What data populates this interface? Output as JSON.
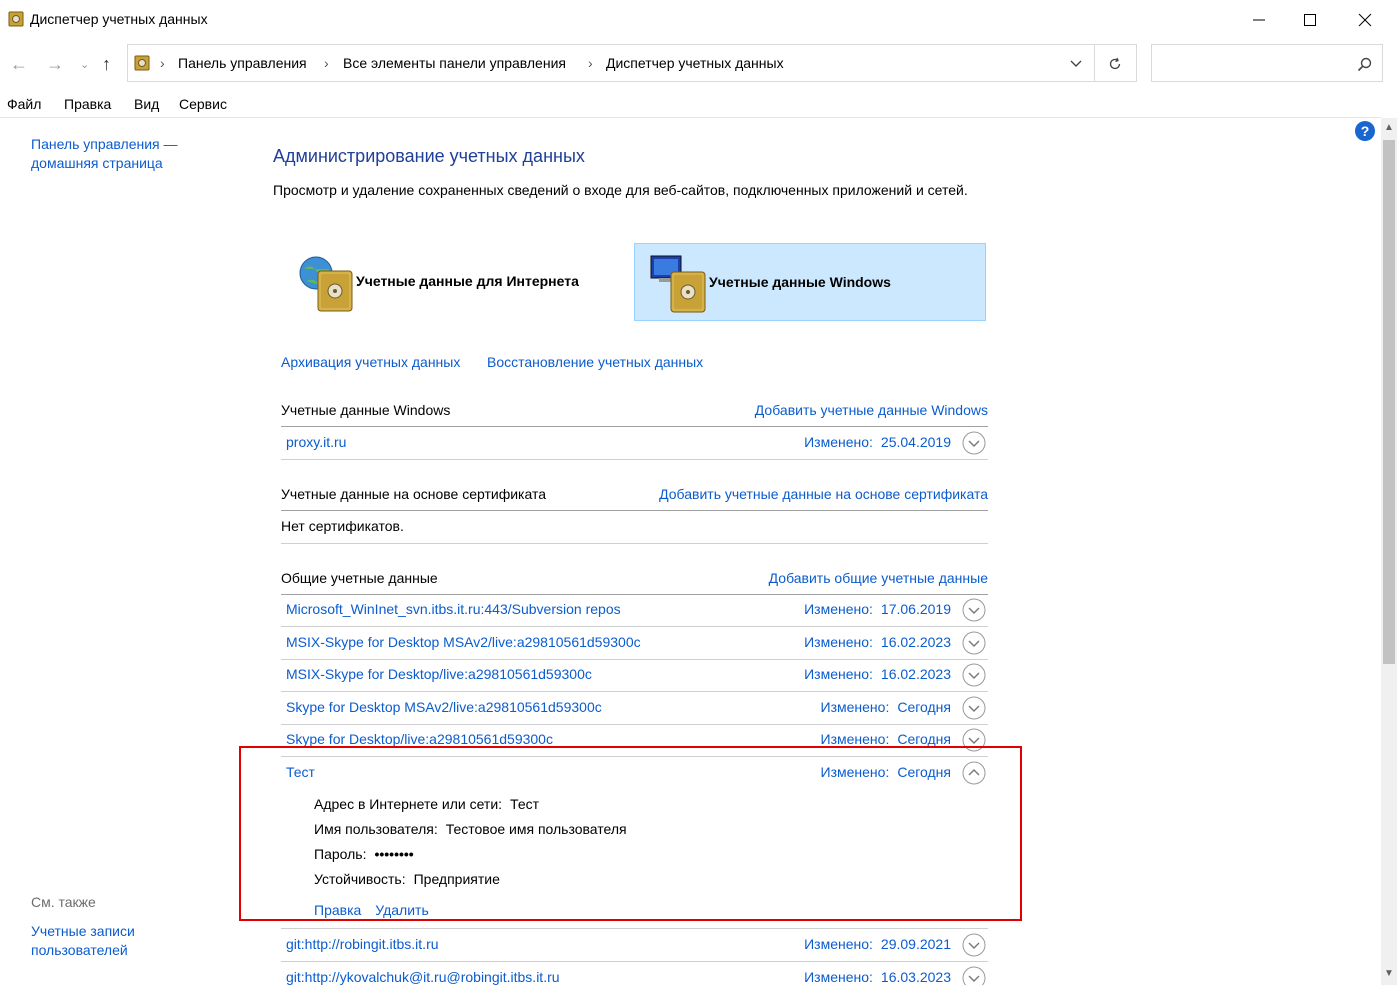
{
  "window": {
    "title": "Диспетчер учетных данных"
  },
  "nav": {
    "breadcrumb": [
      "Панель управления",
      "Все элементы панели управления",
      "Диспетчер учетных данных"
    ],
    "search_placeholder": ""
  },
  "menu": [
    "Файл",
    "Правка",
    "Вид",
    "Сервис"
  ],
  "sidebar": {
    "home_link": "Панель управления — домашняя страница",
    "see_also": "См. также",
    "user_accounts": "Учетные записи пользователей"
  },
  "main": {
    "heading": "Администрирование учетных данных",
    "description": "Просмотр и удаление сохраненных сведений о входе для веб-сайтов, подключенных приложений и сетей.",
    "tiles": [
      {
        "label": "Учетные данные для Интернета",
        "selected": false
      },
      {
        "label": "Учетные данные Windows",
        "selected": true
      }
    ],
    "backup_link": "Архивация учетных данных",
    "restore_link": "Восстановление учетных данных",
    "modified_label": "Изменено:",
    "sections": {
      "windows": {
        "title": "Учетные данные Windows",
        "add_link": "Добавить учетные данные Windows",
        "items": [
          {
            "name": "proxy.it.ru",
            "date": "25.04.2019"
          }
        ]
      },
      "certificate": {
        "title": "Учетные данные на основе сертификата",
        "add_link": "Добавить учетные данные на основе сертификата",
        "empty": "Нет сертификатов."
      },
      "generic": {
        "title": "Общие учетные данные",
        "add_link": "Добавить общие учетные данные",
        "items": [
          {
            "name": "Microsoft_WinInet_svn.itbs.it.ru:443/Subversion repos",
            "date": "17.06.2019"
          },
          {
            "name": "MSIX-Skype for Desktop MSAv2/live:a29810561d59300c",
            "date": "16.02.2023"
          },
          {
            "name": "MSIX-Skype for Desktop/live:a29810561d59300c",
            "date": "16.02.2023"
          },
          {
            "name": "Skype for Desktop MSAv2/live:a29810561d59300c",
            "date": "Сегодня"
          },
          {
            "name": "Skype for Desktop/live:a29810561d59300c",
            "date": "Сегодня"
          },
          {
            "name": "Тест",
            "date": "Сегодня",
            "expanded": true
          },
          {
            "name": "git:http://robingit.itbs.it.ru",
            "date": "29.09.2021"
          },
          {
            "name": "git:http://ykovalchuk@it.ru@robingit.itbs.it.ru",
            "date": "16.03.2023"
          }
        ],
        "expanded_details": {
          "address_label": "Адрес в Интернете или сети:",
          "address_value": "Тест",
          "username_label": "Имя пользователя:",
          "username_value": "Тестовое имя пользователя",
          "password_label": "Пароль:",
          "password_value": "••••••••",
          "persistence_label": "Устойчивость:",
          "persistence_value": "Предприятие",
          "edit_link": "Правка",
          "delete_link": "Удалить"
        }
      }
    }
  },
  "colors": {
    "link": "#0b5ccf",
    "heading": "#1e3f9a",
    "selected_tile": "#cce8ff",
    "highlight": "#e00000"
  }
}
